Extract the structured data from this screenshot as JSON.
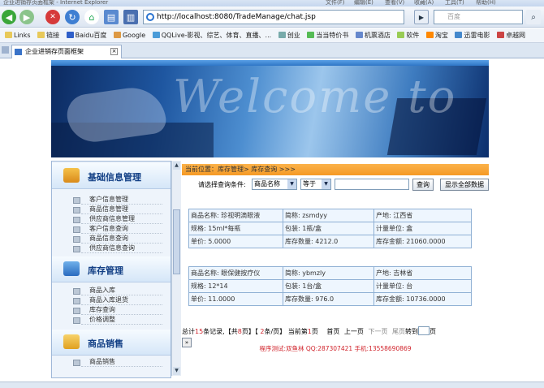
{
  "window": {
    "title_left": "企业进销存页面框架 - Internet Explorer",
    "menu_items": [
      "文件(F)",
      "编辑(E)",
      "查看(V)",
      "收藏(A)",
      "工具(T)",
      "帮助(H)"
    ]
  },
  "nav": {
    "address": "http://localhost:8080/TradeManage/chat.jsp",
    "search_placeholder": "百度"
  },
  "links": [
    "Links",
    "链接",
    "Baidu百度",
    "Google",
    "QQLive-影视、综艺、体育、直播、...",
    "创业",
    "当当特价书",
    "机票酒店",
    "软件",
    "淘宝",
    "迅雷电影",
    "卓越网"
  ],
  "tab": {
    "label": "企业进销存页面框架"
  },
  "banner": {
    "text": "Welcome to"
  },
  "sidebar": {
    "sections": [
      {
        "title": "基础信息管理",
        "items": [
          "客户信息管理",
          "商品信息管理",
          "供应商信息管理",
          "客户信息查询",
          "商品信息查询",
          "供应商信息查询"
        ]
      },
      {
        "title": "库存管理",
        "items": [
          "商品入库",
          "商品入库退货",
          "库存查询",
          "价格调整"
        ]
      },
      {
        "title": "商品销售",
        "items": [
          "商品销售"
        ]
      }
    ]
  },
  "crumb": "当前位置：库存管理> 库存查询 >>>",
  "query": {
    "label": "请选择查询条件:",
    "field": "商品名称",
    "op": "等于",
    "value": "",
    "search": "查询",
    "showall": "显示全部数据"
  },
  "products": [
    {
      "name": "商品名称: 珍视明滴眼液",
      "abbr": "简称: zsmdyy",
      "origin": "产地: 江西省",
      "spec": "规格: 15ml*每瓶",
      "pack": "包装: 1瓶/盒",
      "unit": "计量单位: 盒",
      "price": "单价: 5.0000",
      "qty": "库存数量: 4212.0",
      "amount": "库存金额: 21060.0000"
    },
    {
      "name": "商品名称: 眼保健按疗仪",
      "abbr": "简称: ybmzly",
      "origin": "产地: 吉林省",
      "spec": "规格: 12*14",
      "pack": "包装: 1台/盒",
      "unit": "计量单位: 台",
      "price": "单价: 11.0000",
      "qty": "库存数量: 976.0",
      "amount": "库存金额: 10736.0000"
    }
  ],
  "pager": {
    "p1": "总计",
    "total": "15",
    "p2": "条记录,【共",
    "pages": "8",
    "p3": "页】【 ",
    "size": "2",
    "p4": "条/页】 当前第",
    "cur": "1",
    "p5": "页",
    "first": "首页",
    "prev": "上一页",
    "next": "下一页",
    "last": "尾页",
    "goto": "转到",
    "pg": "页"
  },
  "footer": "程序测试:双鱼林 QQ:287307421 手机:13558690869"
}
